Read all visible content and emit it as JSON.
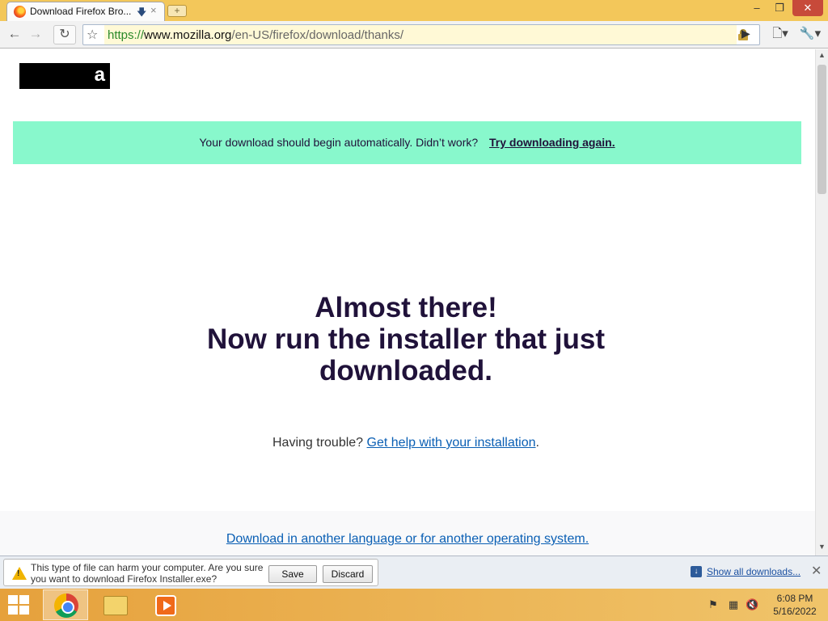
{
  "tab": {
    "title": "Download Firefox Bro...",
    "download_icon": "download-arrow-icon",
    "close": "×"
  },
  "new_tab_label": "+",
  "window": {
    "minimize": "‒",
    "maximize": "❐",
    "close": "✕"
  },
  "toolbar": {
    "back": "←",
    "forward": "→",
    "reload": "↻",
    "star": "☆",
    "go": "▶",
    "page_menu": "🗋▾",
    "wrench_menu": "🔧▾",
    "url_scheme": "https://",
    "url_host": "www.mozilla.org",
    "url_path": "/en-US/firefox/download/thanks/"
  },
  "page": {
    "logo_letter": "a",
    "notice_text": "Your download should begin automatically. Didn’t work?",
    "notice_link": "Try downloading again.",
    "headline_line1": "Almost there!",
    "headline_line2": "Now run the installer that just downloaded.",
    "trouble_text": "Having trouble?",
    "trouble_link": "Get help with your installation",
    "trouble_suffix": ".",
    "alt_download_link": "Download in another language or for another operating system."
  },
  "scrollbar": {
    "up": "▲",
    "down": "▼"
  },
  "download_shelf": {
    "warning": "This type of file can harm your computer. Are you sure you want to download Firefox Installer.exe?",
    "save": "Save",
    "discard": "Discard",
    "show_all": "Show all downloads...",
    "close": "✕"
  },
  "taskbar": {
    "apps": [
      "Google Chrome",
      "File Explorer",
      "Windows Media Player"
    ],
    "tray_icons": [
      "action-center-flag-icon",
      "network-icon",
      "volume-muted-icon"
    ],
    "time": "6:08 PM",
    "date": "5/16/2022"
  }
}
